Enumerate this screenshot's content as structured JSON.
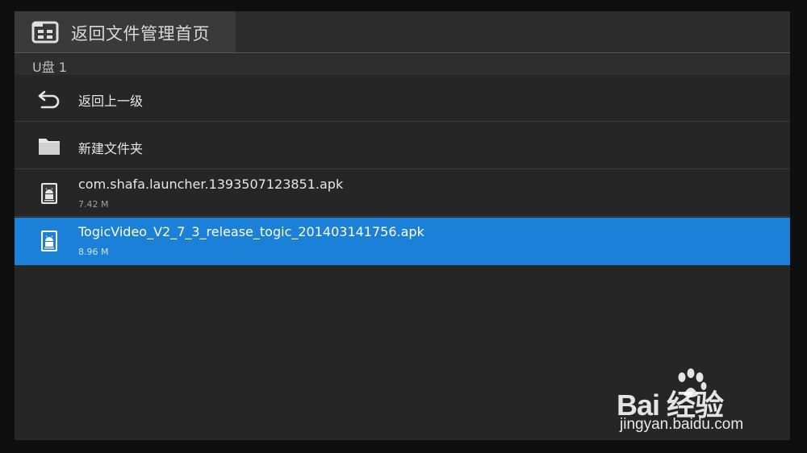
{
  "header": {
    "home_label": "返回文件管理首页",
    "home_icon": "file-manager-icon"
  },
  "location": {
    "label": "U盘 1"
  },
  "items": [
    {
      "type": "action",
      "icon": "back-arrow-icon",
      "label": "返回上一级"
    },
    {
      "type": "action",
      "icon": "folder-icon",
      "label": "新建文件夹"
    },
    {
      "type": "file",
      "icon": "android-apk-icon",
      "label": "com.shafa.launcher.1393507123851.apk",
      "size": "7.42 M",
      "selected": false
    },
    {
      "type": "file",
      "icon": "android-apk-icon",
      "label": "TogicVideo_V2_7_3_release_togic_201403141756.apk",
      "size": "8.96 M",
      "selected": true
    }
  ],
  "watermark": {
    "brand": "Bai  经验",
    "url": "jingyan.baidu.com"
  },
  "colors": {
    "selection": "#1a80d8",
    "background": "#262626",
    "header": "#3a3a3a"
  }
}
